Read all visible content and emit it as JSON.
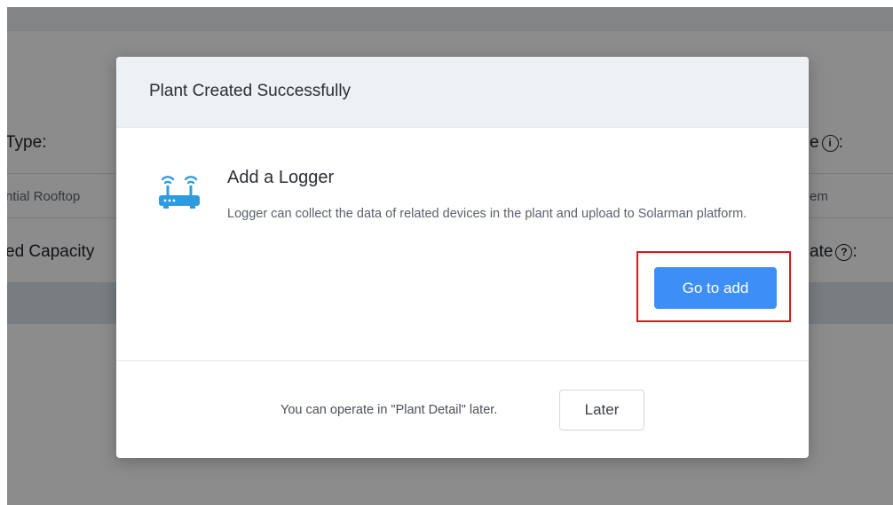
{
  "background": {
    "left_labels": [
      "Type:",
      "ed Capacity"
    ],
    "left_value": "ntial Rooftop",
    "right_labels": [
      "e",
      "ate"
    ],
    "right_label_icons": [
      "info-icon",
      "help-icon"
    ],
    "right_label_icon_glyphs": [
      "i",
      "?"
    ],
    "right_value": "em"
  },
  "modal": {
    "title": "Plant Created Successfully",
    "card": {
      "icon": "router-icon",
      "title": "Add a Logger",
      "description": "Logger can collect the data of related devices in the plant and upload to Solarman platform.",
      "primary_button": "Go to add"
    },
    "footer": {
      "hint": "You can operate in \"Plant Detail\" later.",
      "secondary_button": "Later"
    }
  },
  "colors": {
    "primary": "#3e8ef7",
    "highlight": "#e0141b",
    "router_icon": "#2e9be0"
  }
}
